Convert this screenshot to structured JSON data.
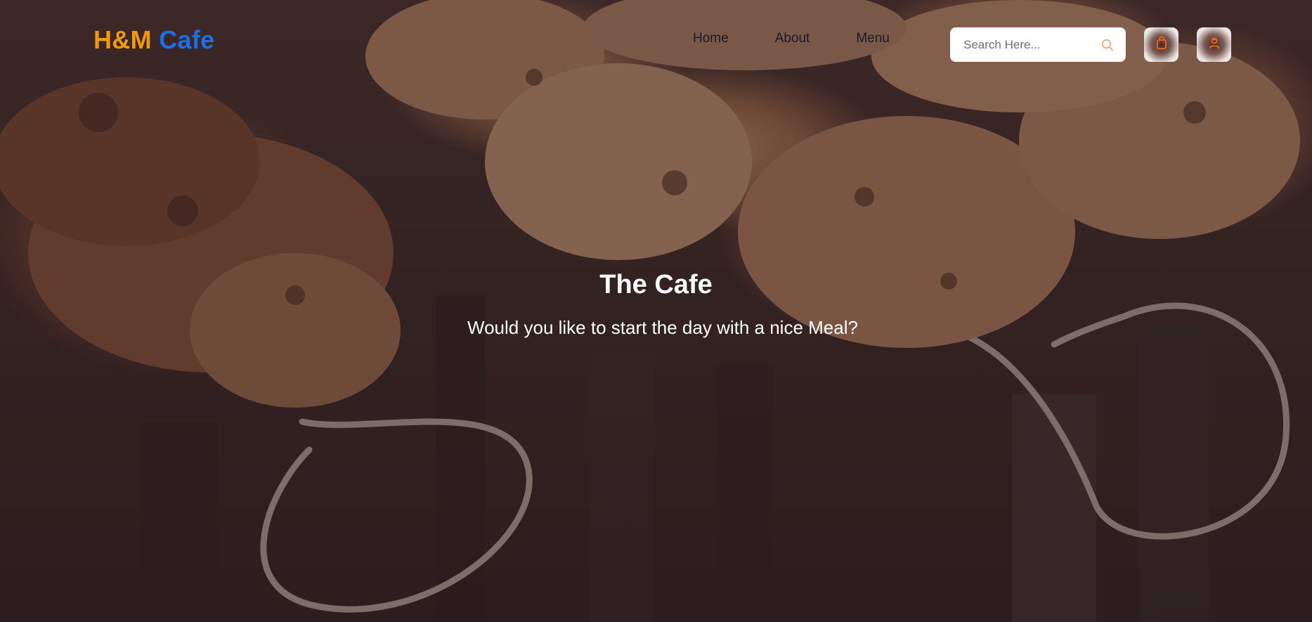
{
  "logo": {
    "part1": "H&M",
    "part2": "Cafe"
  },
  "nav": {
    "items": [
      {
        "label": "Home"
      },
      {
        "label": "About"
      },
      {
        "label": "Menu"
      }
    ]
  },
  "search": {
    "placeholder": "Search Here...",
    "value": "",
    "icon": "search-icon"
  },
  "actions": {
    "cart_icon": "shopping-bag-icon",
    "user_icon": "user-icon"
  },
  "hero": {
    "title": "The Cafe",
    "subtitle": "Would you like to start the day with a nice Meal?"
  },
  "colors": {
    "logo_primary": "#f29a0e",
    "logo_secondary": "#1e6fe6",
    "accent": "#f26b1d",
    "nav_text": "#1b1a2e"
  }
}
